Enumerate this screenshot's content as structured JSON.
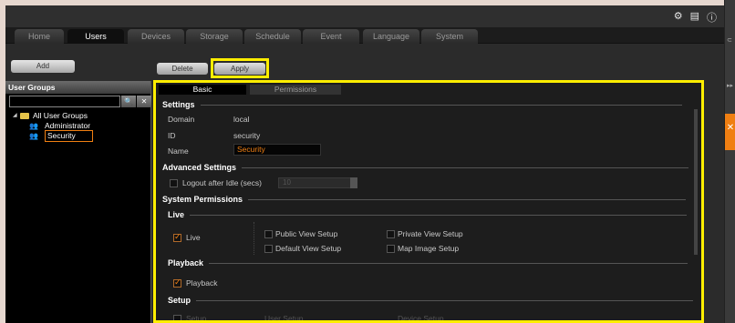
{
  "topbar": {
    "icons": [
      "gear-icon",
      "document-icon",
      "info-icon"
    ]
  },
  "nav": {
    "tabs": [
      {
        "label": "Home",
        "active": false
      },
      {
        "label": "Users",
        "active": true
      },
      {
        "label": "Devices",
        "active": false
      },
      {
        "label": "Storage",
        "active": false
      },
      {
        "label": "Schedule",
        "active": false
      },
      {
        "label": "Event",
        "active": false
      },
      {
        "label": "Language",
        "active": false
      },
      {
        "label": "System",
        "active": false
      }
    ]
  },
  "left": {
    "add_label": "Add",
    "title": "User Groups",
    "search_placeholder": "",
    "tree": {
      "root": "All User Groups",
      "children": [
        "Administrator",
        "Security"
      ]
    }
  },
  "toolbar": {
    "delete_label": "Delete",
    "apply_label": "Apply"
  },
  "tabs": {
    "basic": "Basic",
    "permissions": "Permissions"
  },
  "settings": {
    "title": "Settings",
    "domain_label": "Domain",
    "domain_value": "local",
    "id_label": "ID",
    "id_value": "security",
    "name_label": "Name",
    "name_value": "Security"
  },
  "advanced": {
    "title": "Advanced Settings",
    "logout_label": "Logout after Idle (secs)",
    "logout_value": "10",
    "logout_checked": false
  },
  "permissions": {
    "title": "System Permissions",
    "live": {
      "title": "Live",
      "live_label": "Live",
      "live_checked": true,
      "public_view": "Public View Setup",
      "private_view": "Private View Setup",
      "default_view": "Default View Setup",
      "map_image": "Map Image Setup"
    },
    "playback": {
      "title": "Playback",
      "playback_label": "Playback",
      "playback_checked": true
    },
    "setup": {
      "title": "Setup",
      "setup_label": "Setup",
      "user_setup": "User Setup",
      "device_setup": "Device Setup"
    }
  },
  "colors": {
    "highlight": "#ffee00",
    "accent": "#f07f12"
  }
}
